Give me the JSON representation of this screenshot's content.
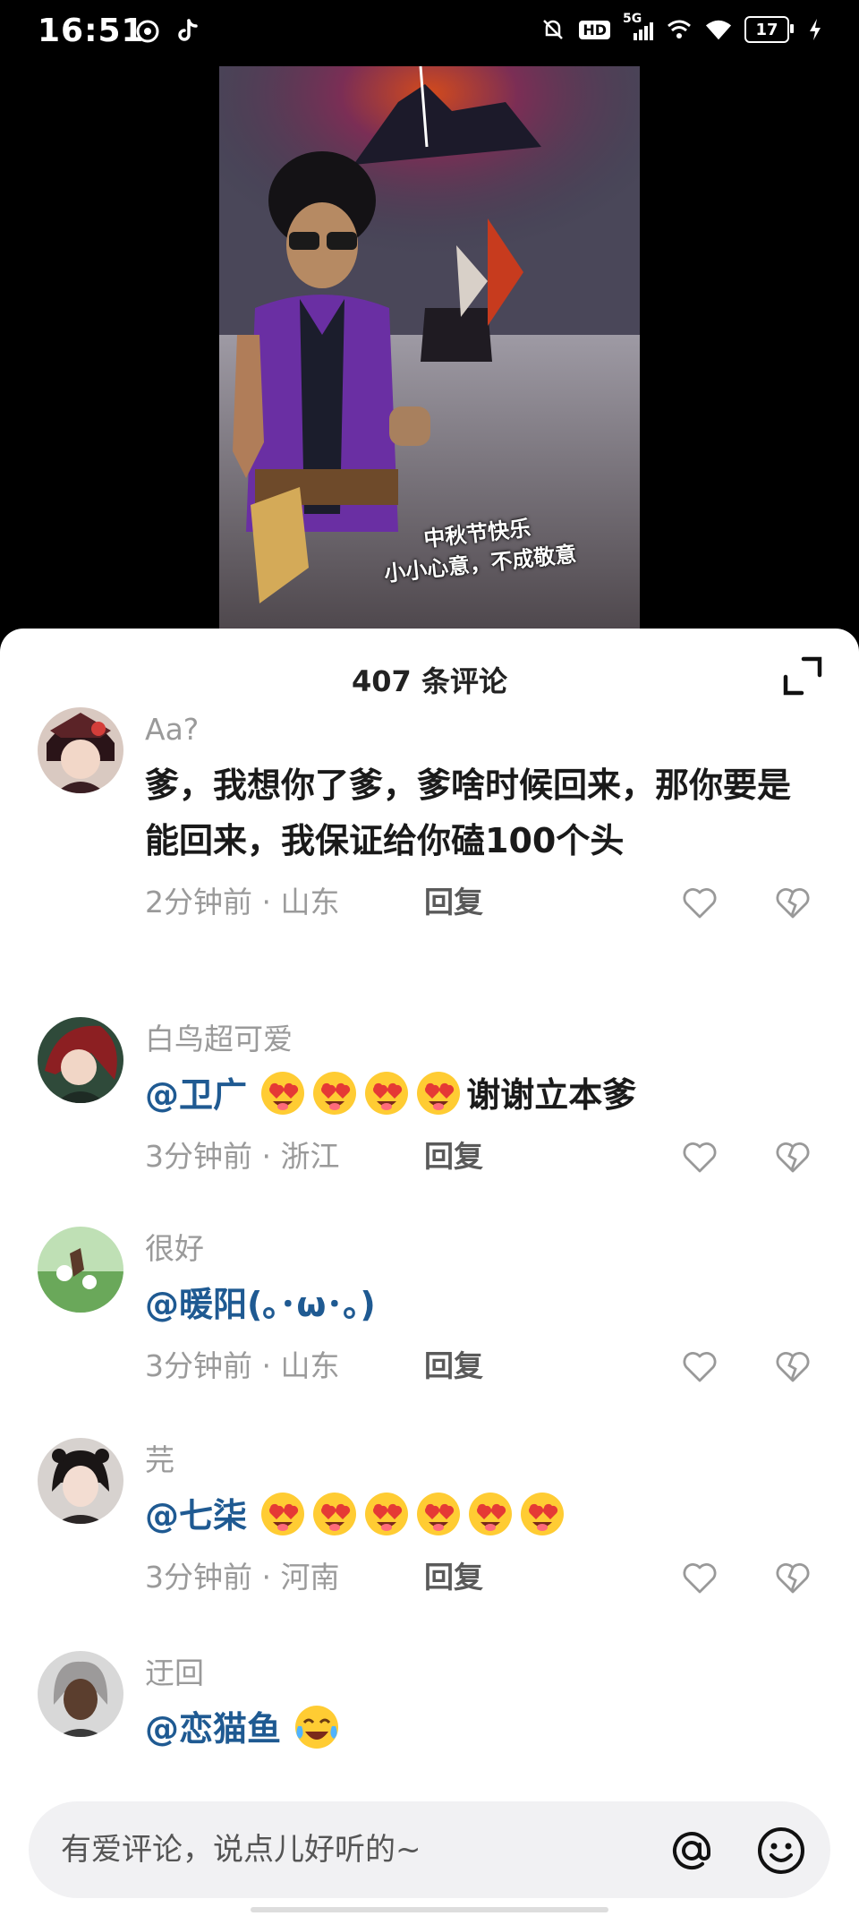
{
  "status_bar": {
    "time": "16:51",
    "network": "5G",
    "hd": "HD",
    "battery": "17"
  },
  "video": {
    "caption_line1": "中秋节快乐",
    "caption_line2": "小小心意，不成敬意"
  },
  "comments_panel": {
    "title": "407 条评论"
  },
  "comments": [
    {
      "user": "Aa?",
      "text": "爹，我想你了爹，爹啥时候回来，那你要是能回来，我保证给你磕100个头",
      "mention": "",
      "suffix": "",
      "time": "2分钟前 · 山东",
      "reply": "回复"
    },
    {
      "user": "白鸟超可爱",
      "mention": "@卫广",
      "suffix": "谢谢立本爹",
      "time": "3分钟前 · 浙江",
      "reply": "回复"
    },
    {
      "user": "很好",
      "mention": "@暖阳(｡･ω･｡)",
      "suffix": "",
      "time": "3分钟前 · 山东",
      "reply": "回复"
    },
    {
      "user": "芫",
      "mention": "@七柒",
      "suffix": "",
      "time": "3分钟前 · 河南",
      "reply": "回复"
    },
    {
      "user": "迂回",
      "mention": "@恋猫鱼",
      "suffix": "",
      "time": "",
      "reply": ""
    }
  ],
  "input": {
    "placeholder": "有爱评论，说点儿好听的~"
  },
  "colors": {
    "mention": "#1f5a92",
    "meta": "#9a9a9a",
    "background": "#ffffff"
  }
}
